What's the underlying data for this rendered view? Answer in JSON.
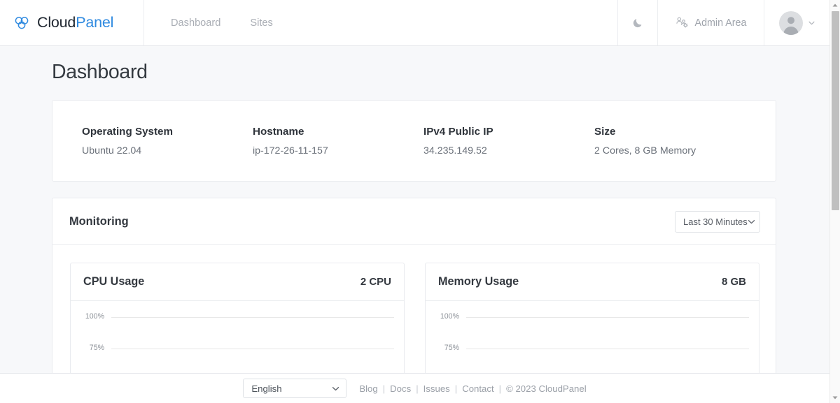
{
  "header": {
    "brand": {
      "logo_icon": "cloud-logo-icon",
      "name_part1": "Cloud",
      "name_part2": "Panel"
    },
    "nav": [
      {
        "label": "Dashboard",
        "name": "nav-item-dashboard"
      },
      {
        "label": "Sites",
        "name": "nav-item-sites"
      }
    ],
    "theme_toggle": {
      "icon": "moon-icon"
    },
    "admin": {
      "icon": "users-gear-icon",
      "label": "Admin Area"
    },
    "user": {
      "avatar_icon": "user-avatar-icon",
      "caret_icon": "caret-down-icon"
    }
  },
  "page": {
    "title": "Dashboard"
  },
  "info_card": {
    "items": [
      {
        "label": "Operating System",
        "value": "Ubuntu 22.04"
      },
      {
        "label": "Hostname",
        "value": "ip-172-26-11-157"
      },
      {
        "label": "IPv4 Public IP",
        "value": "34.235.149.52"
      },
      {
        "label": "Size",
        "value": "2 Cores, 8 GB Memory"
      }
    ]
  },
  "monitoring": {
    "title": "Monitoring",
    "range": {
      "selected": "Last 30 Minutes",
      "icon": "chevron-down-icon"
    },
    "charts": [
      {
        "title": "CPU Usage",
        "meta": "2 CPU",
        "gridlines": [
          {
            "label": "100%",
            "top": 23
          },
          {
            "label": "75%",
            "top": 68
          }
        ]
      },
      {
        "title": "Memory Usage",
        "meta": "8 GB",
        "gridlines": [
          {
            "label": "100%",
            "top": 23
          },
          {
            "label": "75%",
            "top": 68
          }
        ]
      }
    ]
  },
  "chart_data": [
    {
      "type": "line",
      "title": "CPU Usage",
      "meta": "2 CPU",
      "xlabel": "",
      "ylabel": "",
      "ylim": [
        0,
        100
      ],
      "yticks": [
        100,
        75
      ],
      "ytick_labels": [
        "100%",
        "75%"
      ],
      "grid": true,
      "series": [],
      "note": "Plot area visible shows only gridlines at 100% and 75%; remainder clipped below viewport"
    },
    {
      "type": "line",
      "title": "Memory Usage",
      "meta": "8 GB",
      "xlabel": "",
      "ylabel": "",
      "ylim": [
        0,
        100
      ],
      "yticks": [
        100,
        75
      ],
      "ytick_labels": [
        "100%",
        "75%"
      ],
      "grid": true,
      "series": [],
      "note": "Plot area visible shows only gridlines at 100% and 75%; remainder clipped below viewport"
    }
  ],
  "footer": {
    "language": {
      "selected": "English",
      "icon": "chevron-down-icon"
    },
    "links": [
      {
        "label": "Blog"
      },
      {
        "label": "Docs"
      },
      {
        "label": "Issues"
      },
      {
        "label": "Contact"
      }
    ],
    "separator": "|",
    "copyright": "© 2023  CloudPanel"
  },
  "scrollbar": {
    "up_icon": "scroll-up-arrow-icon",
    "down_icon": "scroll-down-arrow-icon"
  },
  "colors": {
    "brand_accent": "#2f8ae0",
    "page_bg": "#f7f8fa",
    "card_bg": "#ffffff",
    "border": "#e9ebef",
    "text_primary": "#33383f",
    "text_muted": "#9ba0a8"
  }
}
